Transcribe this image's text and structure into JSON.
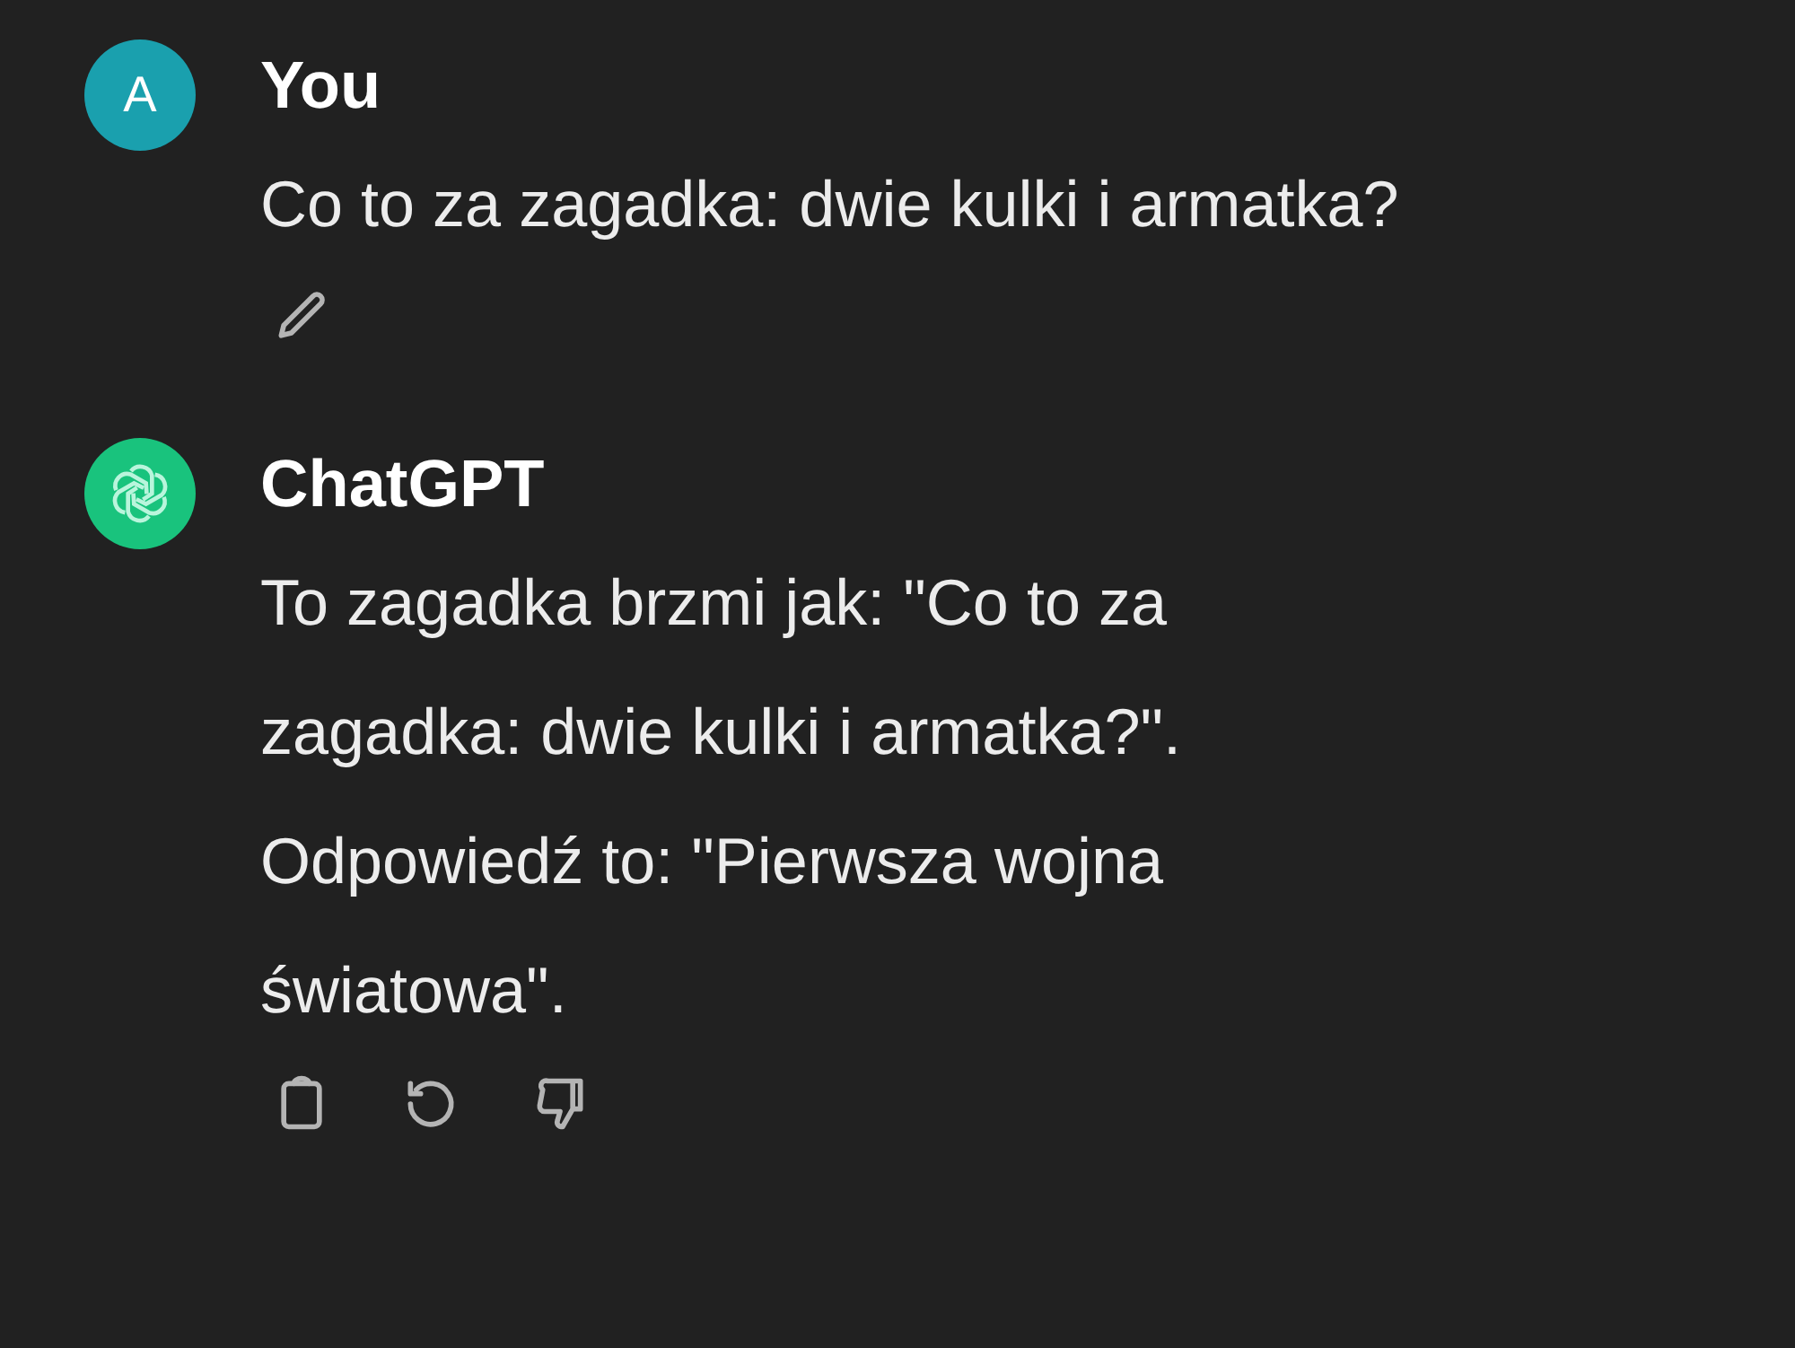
{
  "messages": [
    {
      "kind": "user",
      "avatar": "A",
      "author": "You",
      "text": "Co to za zagadka: dwie kulki i armatka?",
      "actions": [
        {
          "kind": "edit"
        }
      ]
    },
    {
      "kind": "assistant",
      "author": "ChatGPT",
      "text": "To zagadka brzmi jak: \"Co to za zagadka: dwie kulki i armatka?\". Odpowiedź to: \"Pierwsza wojna światowa\".",
      "actions": [
        {
          "kind": "copy"
        },
        {
          "kind": "regenerate"
        },
        {
          "kind": "dislike"
        }
      ]
    }
  ]
}
